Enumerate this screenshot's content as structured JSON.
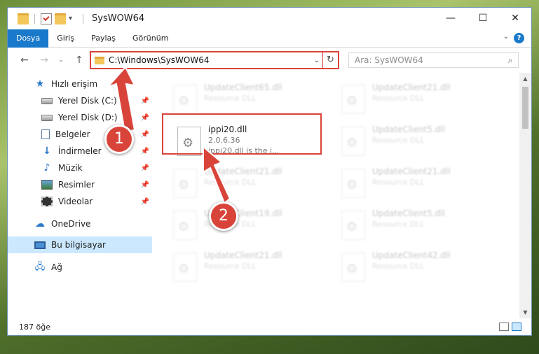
{
  "window": {
    "title": "SysWOW64"
  },
  "winbtns": {
    "minimize": "—",
    "maximize": "☐",
    "close": "✕"
  },
  "ribbon": {
    "tabs": [
      "Dosya",
      "Giriş",
      "Paylaş",
      "Görünüm"
    ],
    "help": "?"
  },
  "address": {
    "path": "C:\\Windows\\SysWOW64",
    "refresh": "↻",
    "dropdown": "⌄"
  },
  "nav": {
    "back": "←",
    "forward": "→",
    "recent": "⌄",
    "up": "↑"
  },
  "search": {
    "placeholder": "Ara: SysWOW64",
    "icon": "⌕"
  },
  "sidebar": {
    "quick_access": "Hızlı erişim",
    "items": [
      {
        "label": "Yerel Disk (C:)",
        "icon": "drive-icon"
      },
      {
        "label": "Yerel Disk (D:)",
        "icon": "drive-icon"
      },
      {
        "label": "Belgeler",
        "icon": "documents-icon"
      },
      {
        "label": "İndirmeler",
        "icon": "downloads-icon"
      },
      {
        "label": "Müzik",
        "icon": "music-icon"
      },
      {
        "label": "Resimler",
        "icon": "pictures-icon"
      },
      {
        "label": "Videolar",
        "icon": "videos-icon"
      }
    ],
    "onedrive": "OneDrive",
    "this_pc": "Bu bilgisayar",
    "network": "Ağ"
  },
  "files": [
    {
      "name": "UpdateClient65.dll",
      "desc": "Resource DLL"
    },
    {
      "name": "UpdateClient21.dll",
      "desc": "Resource DLL"
    },
    {
      "name": "ippi20.dll",
      "version": "2.0.6.36",
      "desc": "ippi20.dll is the i..."
    },
    {
      "name": "UpdateClient5.dll",
      "desc": "Resource DLL"
    },
    {
      "name": "UpdateClient21.dll",
      "desc": "Resource DLL"
    },
    {
      "name": "UpdateClient21.dll",
      "desc": "Resource DLL"
    },
    {
      "name": "UpdateClient19.dll",
      "desc": "Resource DLL"
    },
    {
      "name": "UpdateClient5.dll",
      "desc": "Resource DLL"
    },
    {
      "name": "UpdateClient21.dll",
      "desc": "Resource DLL"
    },
    {
      "name": "UpdateClient42.dll",
      "desc": "Resource DLL"
    }
  ],
  "status": {
    "count": "187 öğe"
  },
  "annotations": {
    "step1": "1",
    "step2": "2",
    "color": "#d9443a"
  }
}
